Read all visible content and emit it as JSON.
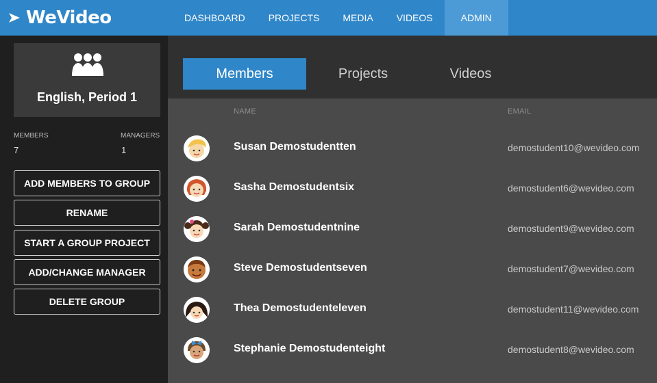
{
  "app": {
    "logo_text": "WeVideo"
  },
  "nav": [
    {
      "label": "DASHBOARD",
      "active": false
    },
    {
      "label": "PROJECTS",
      "active": false
    },
    {
      "label": "MEDIA",
      "active": false
    },
    {
      "label": "VIDEOS",
      "active": false
    },
    {
      "label": "ADMIN",
      "active": true
    }
  ],
  "group": {
    "icon": "group-users-icon",
    "name": "English, Period 1",
    "members_label": "MEMBERS",
    "members_count": "7",
    "managers_label": "MANAGERS",
    "managers_count": "1"
  },
  "actions": [
    {
      "label": "ADD MEMBERS TO GROUP"
    },
    {
      "label": "RENAME"
    },
    {
      "label": "START A GROUP PROJECT"
    },
    {
      "label": "ADD/CHANGE MANAGER"
    },
    {
      "label": "DELETE GROUP"
    }
  ],
  "tabs": [
    {
      "label": "Members",
      "active": true
    },
    {
      "label": "Projects",
      "active": false
    },
    {
      "label": "Videos",
      "active": false
    }
  ],
  "table": {
    "columns": {
      "name": "NAME",
      "email": "EMAIL"
    },
    "rows": [
      {
        "avatar": "girl-blonde-avatar-icon",
        "name": "Susan Demostudentten",
        "email": "demostudent10@wevideo.com"
      },
      {
        "avatar": "girl-redhead-avatar-icon",
        "name": "Sasha Demostudentsix",
        "email": "demostudent6@wevideo.com"
      },
      {
        "avatar": "girl-pigtails-avatar-icon",
        "name": "Sarah Demostudentnine",
        "email": "demostudent9@wevideo.com"
      },
      {
        "avatar": "boy-avatar-icon",
        "name": "Steve Demostudentseven",
        "email": "demostudent7@wevideo.com"
      },
      {
        "avatar": "girl-darkhair-avatar-icon",
        "name": "Thea Demostudenteleven",
        "email": "demostudent11@wevideo.com"
      },
      {
        "avatar": "girl-bow-avatar-icon",
        "name": "Stephanie Demostudenteight",
        "email": "demostudent8@wevideo.com"
      }
    ]
  },
  "colors": {
    "brand": "#2f86c8",
    "nav_active": "#4c9bd6",
    "sidebar": "#1f1f1f",
    "content": "#4a4a4a"
  }
}
